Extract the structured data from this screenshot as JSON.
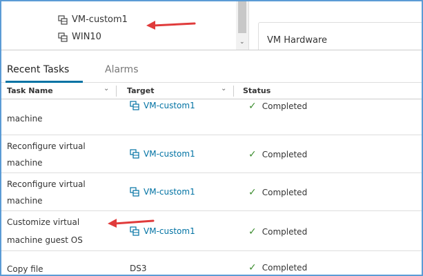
{
  "inventory": {
    "items": [
      {
        "label": "VM-custom1",
        "icon": "vm-icon"
      },
      {
        "label": "WIN10",
        "icon": "vm-icon"
      }
    ],
    "panel_title": "VM Hardware"
  },
  "tabs": [
    {
      "label": "Recent Tasks",
      "active": true
    },
    {
      "label": "Alarms",
      "active": false
    }
  ],
  "table": {
    "columns": [
      "Task Name",
      "Target",
      "Status"
    ],
    "rows": [
      {
        "task_line1": "",
        "task_line2": "machine",
        "target": "VM-custom1",
        "target_icon": true,
        "status": "Completed"
      },
      {
        "task_line1": "Reconfigure virtual",
        "task_line2": "machine",
        "target": "VM-custom1",
        "target_icon": true,
        "status": "Completed"
      },
      {
        "task_line1": "Reconfigure virtual",
        "task_line2": "machine",
        "target": "VM-custom1",
        "target_icon": true,
        "status": "Completed"
      },
      {
        "task_line1": "Customize virtual",
        "task_line2": "machine guest OS",
        "target": "VM-custom1",
        "target_icon": true,
        "status": "Completed"
      },
      {
        "task_line1": "Copy file",
        "task_line2": "",
        "target": "DS3",
        "target_icon": false,
        "status": "Completed"
      }
    ]
  },
  "colors": {
    "accent": "#0072a3",
    "success": "#3c8d2f",
    "annotation_arrow": "#e03b3b",
    "frame_border": "#5b9bd5"
  }
}
